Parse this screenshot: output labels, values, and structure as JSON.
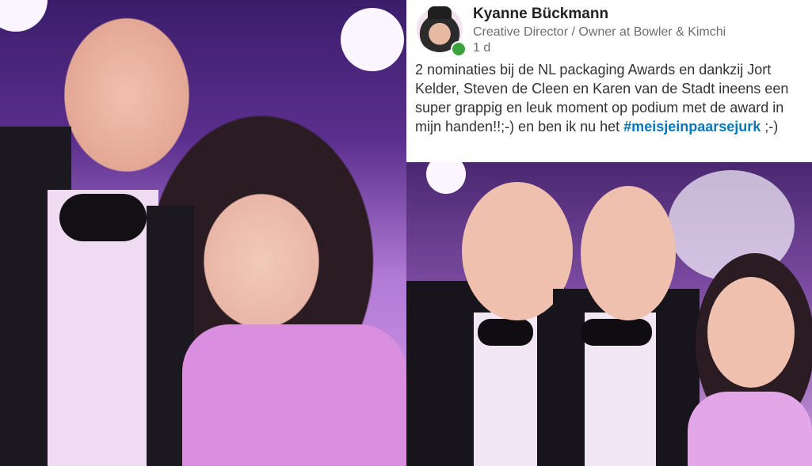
{
  "post": {
    "author": "Kyanne Bückmann",
    "headline": "Creative Director / Owner at Bowler & Kimchi",
    "time": "1 d",
    "text": "2 nominaties bij de NL packaging Awards en dankzij Jort Kelder, Steven de Cleen en Karen van de Stadt ineens een super grappig en leuk moment op podium met de award in mijn handen!!;-) en ben ik nu het ",
    "hashtag": "#meisjeinpaarsejurk",
    "text_end": " ;-)"
  },
  "colors": {
    "hashtag": "#0a78b8",
    "presence": "#3ca33c",
    "name": "#222222",
    "meta": "#6e6e6e"
  },
  "icons": {
    "presence": "online-dot-icon"
  }
}
